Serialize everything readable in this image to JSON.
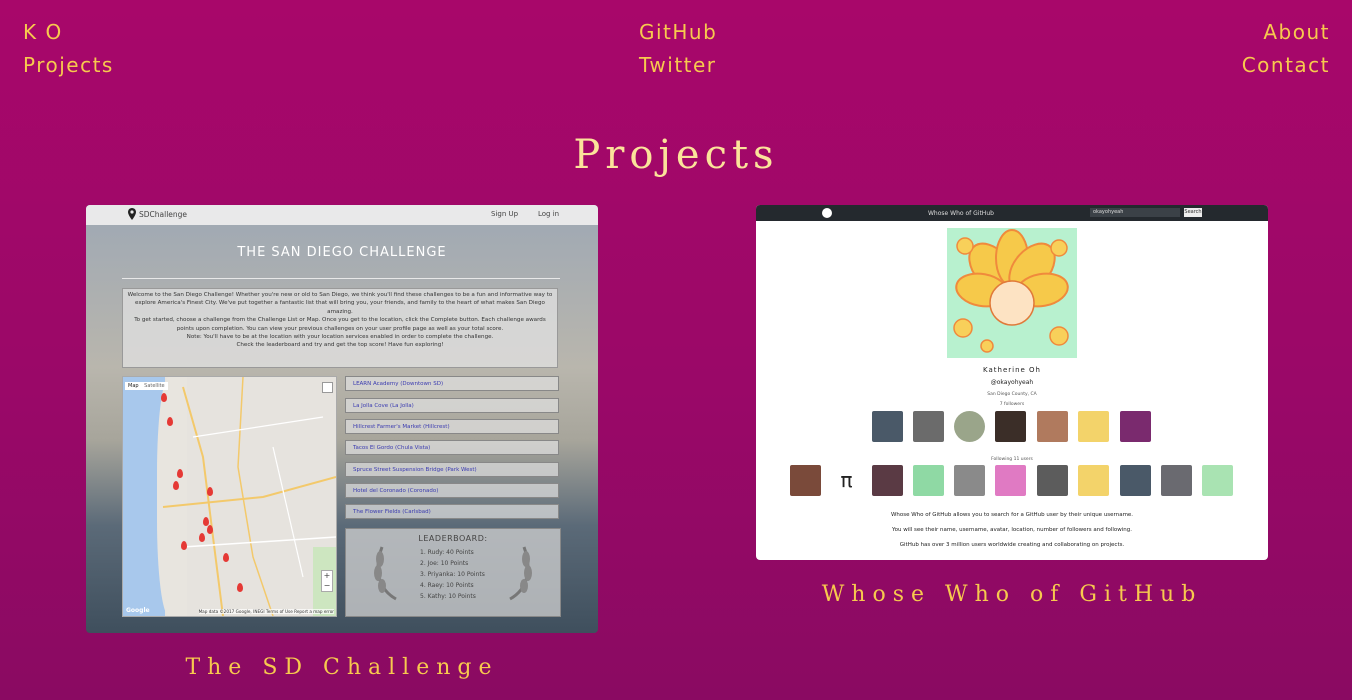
{
  "nav": {
    "initials": "K O",
    "projects": "Projects",
    "github": "GitHub",
    "twitter": "Twitter",
    "about": "About",
    "contact": "Contact"
  },
  "page_title": "Projects",
  "projects": [
    {
      "caption": "The SD Challenge",
      "screenshot": {
        "brand": "SDChallenge",
        "signup": "Sign Up",
        "login": "Log in",
        "title": "THE SAN DIEGO CHALLENGE",
        "intro": [
          "Welcome to the San Diego Challenge! Whether you're new or old to San Diego, we think you'll find these challenges to be a fun and informative way to explore America's Finest City. We've put together a fantastic list that will bring you, your friends, and family to the heart of what makes San Diego amazing.",
          "To get started, choose a challenge from the Challenge List or Map. Once you get to the location, click the Complete button. Each challenge awards points upon completion. You can view your previous challenges on your user profile page as well as your total score.",
          "Note: You'll have to be at the location with your location services enabled in order to complete the challenge.",
          "Check the leaderboard and try and get the top score! Have fun exploring!"
        ],
        "map_tabs": [
          "Map",
          "Satellite"
        ],
        "map_attribution": "Map data ©2017 Google, INEGI   Terms of Use   Report a map error",
        "challenges": [
          "LEARN Academy (Downtown SD)",
          "La Jolla Cove (La Jolla)",
          "Hillcrest Farmer's Market (Hillcrest)",
          "Tacos El Gordo (Chula Vista)",
          "Spruce Street Suspension Bridge (Park West)",
          "Hotel del Coronado (Coronado)",
          "The Flower Fields (Carlsbad)"
        ],
        "leaderboard_title": "LEADERBOARD:",
        "leaderboard": [
          "1. Rudy: 40 Points",
          "2. Joe: 10 Points",
          "3. Priyanka: 10 Points",
          "4. Raey: 10 Points",
          "5. Kathy: 10 Points"
        ]
      }
    },
    {
      "caption": "Whose Who of GitHub",
      "screenshot": {
        "app_title": "Whose Who of GitHub",
        "search_value": "okayohyeah",
        "search_button": "Search",
        "name": "Katherine Oh",
        "username": "@okayohyeah",
        "location": "San Diego County, CA",
        "followers_label": "7 followers",
        "following_label": "Following 11 users",
        "description": [
          "Whose Who of GitHub allows you to search for a GitHub user by their unique username.",
          "You will see their name, username, avatar, location, number of followers and following.",
          "GitHub has over 3 million users worldwide creating and collaborating on projects."
        ]
      }
    }
  ],
  "colors": {
    "background_top": "#a8076a",
    "background_bottom": "#8a0a62",
    "accent": "#f7c94e",
    "title": "#fbe39a"
  }
}
